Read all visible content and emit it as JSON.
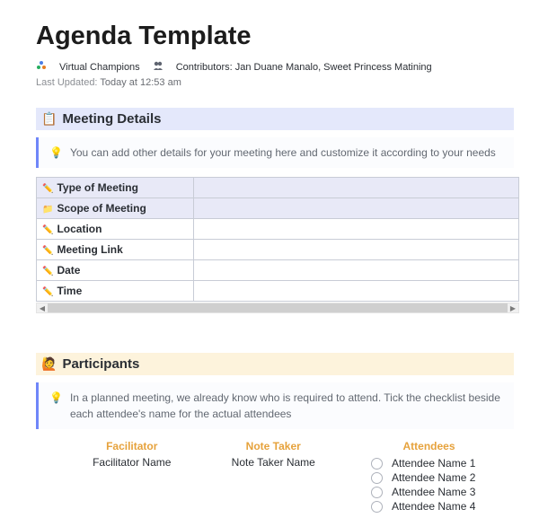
{
  "title": "Agenda Template",
  "meta": {
    "space_name": "Virtual Champions",
    "contributors_label": "Contributors:",
    "contributors": "Jan Duane Manalo, Sweet Princess Matining"
  },
  "updated": {
    "label": "Last Updated:",
    "value": "Today at 12:53 am"
  },
  "sections": {
    "meeting_details": {
      "heading": "Meeting Details",
      "callout": "You can add other details for your meeting here and customize it according to your needs",
      "rows": [
        {
          "label": "Type of Meeting",
          "value": "",
          "icon": "pencil",
          "highlight": true
        },
        {
          "label": "Scope of Meeting",
          "value": "",
          "icon": "folder",
          "highlight": true
        },
        {
          "label": "Location",
          "value": "",
          "icon": "pencil",
          "highlight": false
        },
        {
          "label": "Meeting Link",
          "value": "",
          "icon": "pencil",
          "highlight": false
        },
        {
          "label": "Date",
          "value": "",
          "icon": "pencil",
          "highlight": false
        },
        {
          "label": "Time",
          "value": "",
          "icon": "pencil",
          "highlight": false
        }
      ]
    },
    "participants": {
      "heading": "Participants",
      "callout": "In a planned meeting, we already know who is required to attend. Tick the checklist beside each attendee's name for the actual attendees",
      "columns": {
        "facilitator": {
          "header": "Facilitator",
          "value": "Facilitator Name"
        },
        "note_taker": {
          "header": "Note Taker",
          "value": "Note Taker Name"
        },
        "attendees": {
          "header": "Attendees",
          "items": [
            "Attendee Name 1",
            "Attendee Name 2",
            "Attendee Name 3",
            "Attendee Name 4"
          ]
        }
      }
    }
  },
  "icons": {
    "space": "✳️",
    "contributors": "👥",
    "bulb": "💡",
    "clipboard": "📋",
    "raised_hand": "🙋",
    "pencil": "✏️",
    "folder": "📁"
  }
}
